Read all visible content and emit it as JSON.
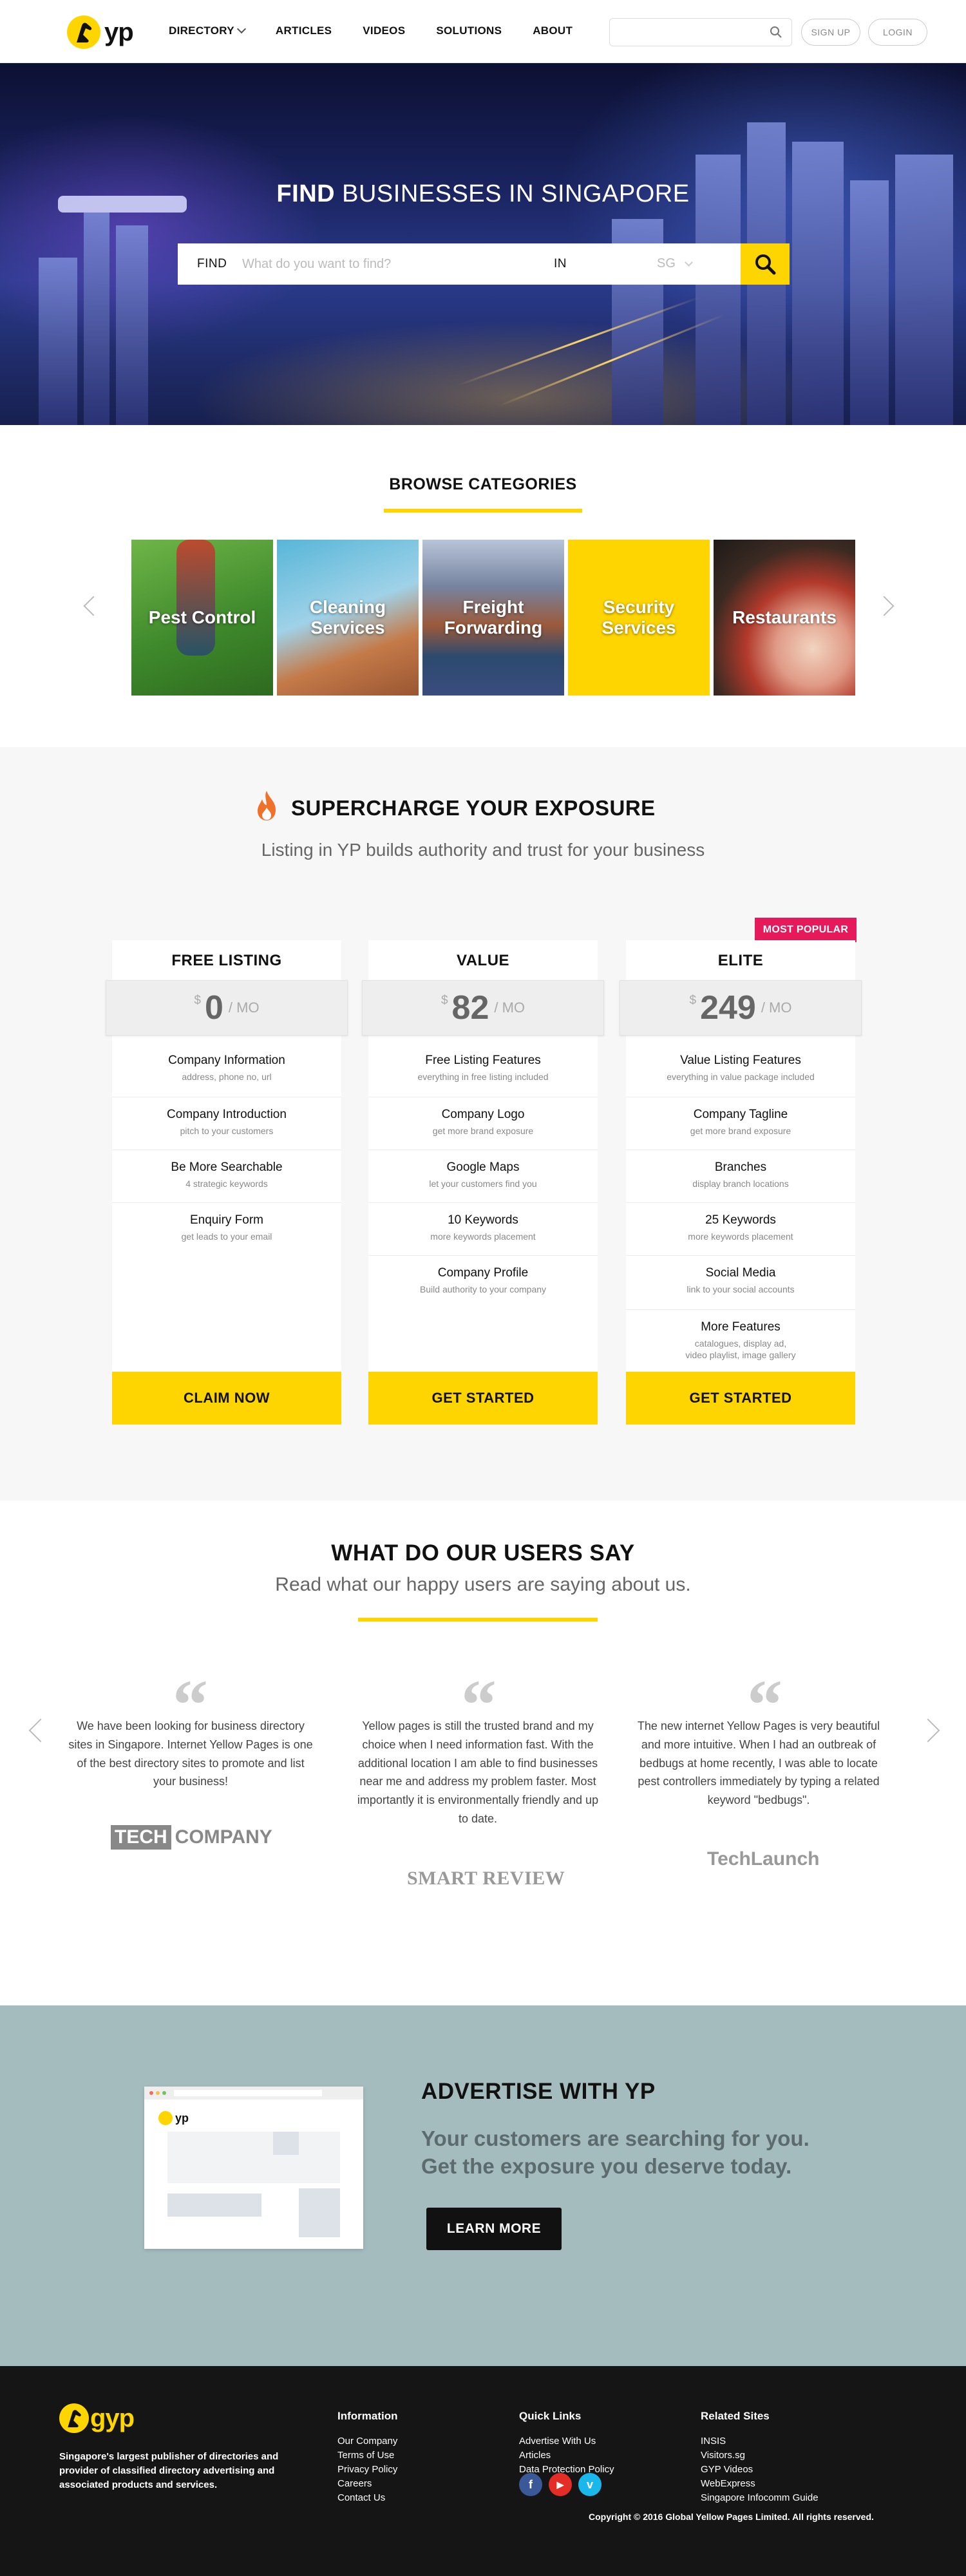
{
  "nav": {
    "logo_text": "yp",
    "menu": [
      {
        "label": "DIRECTORY",
        "has_dropdown": true
      },
      {
        "label": "ARTICLES"
      },
      {
        "label": "VIDEOS"
      },
      {
        "label": "SOLUTIONS"
      },
      {
        "label": "ABOUT"
      }
    ],
    "search_placeholder": "",
    "signup_label": "SIGN UP",
    "login_label": "LOGIN"
  },
  "hero": {
    "title_bold": "FIND",
    "title_rest": "BUSINESSES IN SINGAPORE",
    "find_label": "FIND",
    "find_placeholder": "What do you want to find?",
    "in_label": "IN",
    "location_value": "SG"
  },
  "categories": {
    "heading": "BROWSE CATEGORIES",
    "items": [
      {
        "label": "Pest Control"
      },
      {
        "label": "Cleaning Services"
      },
      {
        "label": "Freight Forwarding"
      },
      {
        "label": "Security Services"
      },
      {
        "label": "Restaurants"
      }
    ]
  },
  "pricing": {
    "title": "SUPERCHARGE YOUR EXPOSURE",
    "subtitle": "Listing in YP builds authority and trust for your business",
    "popular_badge": "MOST POPULAR",
    "plans": [
      {
        "name": "FREE LISTING",
        "currency": "$",
        "amount": "0",
        "per": "/ MO",
        "features": [
          {
            "title": "Company Information",
            "sub": "address, phone no, url"
          },
          {
            "title": "Company Introduction",
            "sub": "pitch to your customers"
          },
          {
            "title": "Be More Searchable",
            "sub": "4 strategic keywords"
          },
          {
            "title": "Enquiry Form",
            "sub": "get leads to your email"
          }
        ],
        "cta": "CLAIM NOW"
      },
      {
        "name": "VALUE",
        "currency": "$",
        "amount": "82",
        "per": "/ MO",
        "features": [
          {
            "title": "Free Listing Features",
            "sub": "everything in free listing included"
          },
          {
            "title": "Company Logo",
            "sub": "get more brand exposure"
          },
          {
            "title": "Google Maps",
            "sub": "let your customers find you"
          },
          {
            "title": "10 Keywords",
            "sub": "more keywords placement"
          },
          {
            "title": "Company Profile",
            "sub": "Build authority to your company"
          }
        ],
        "cta": "GET STARTED"
      },
      {
        "name": "ELITE",
        "currency": "$",
        "amount": "249",
        "per": "/ MO",
        "features": [
          {
            "title": "Value Listing Features",
            "sub": "everything in value package included"
          },
          {
            "title": "Company Tagline",
            "sub": "get more brand exposure"
          },
          {
            "title": "Branches",
            "sub": "display branch locations"
          },
          {
            "title": "25 Keywords",
            "sub": "more keywords placement"
          },
          {
            "title": "Social Media",
            "sub": "link to your social accounts"
          },
          {
            "title": "More Features",
            "sub": "catalogues, display ad,",
            "sub2": "video playlist, image gallery"
          }
        ],
        "cta": "GET STARTED"
      }
    ]
  },
  "testimonials": {
    "title": "WHAT DO OUR USERS SAY",
    "subtitle": "Read what our happy users are saying about us.",
    "items": [
      {
        "text": "We have been looking for business directory sites in Singapore. Internet Yellow Pages is one of the best directory sites to promote and list your business!",
        "brand_box": "TECH",
        "brand_rest": "COMPANY"
      },
      {
        "text": "Yellow pages is still the trusted brand and my choice when I need information fast. With the additional location I am able to find businesses near me and address my problem faster. Most importantly it is environmentally friendly and up to date.",
        "brand": "SMART REVIEW"
      },
      {
        "text": "The new internet Yellow Pages is very beautiful and more intuitive. When I had an outbreak of bedbugs at home recently, I was able to locate pest controllers immediately by typing a related keyword \"bedbugs\".",
        "brand": "TechLaunch"
      }
    ]
  },
  "advertise": {
    "mock_logo": "yp",
    "title": "ADVERTISE WITH YP",
    "line1": "Your customers are searching for you.",
    "line2": "Get the exposure you deserve today.",
    "button": "LEARN MORE"
  },
  "footer": {
    "logo_text": "gyp",
    "about": "Singapore's largest publisher of directories and provider of classified directory advertising and associated products and services.",
    "columns": [
      {
        "heading": "Information",
        "links": [
          "Our Company",
          "Terms of Use",
          "Privacy Policy",
          "Careers",
          "Contact Us"
        ]
      },
      {
        "heading": "Quick Links",
        "links": [
          "Advertise With Us",
          "Articles",
          "Data Protection Policy"
        ]
      },
      {
        "heading": "Related Sites",
        "links": [
          "INSIS",
          "Visitors.sg",
          "GYP Videos",
          "WebExpress",
          "Singapore Infocomm Guide"
        ]
      }
    ],
    "social": [
      "f",
      "▶",
      "v"
    ],
    "copyright": "Copyright © 2016 Global Yellow Pages Limited. All rights reserved."
  },
  "colors": {
    "brand_yellow": "#ffd500",
    "popular_pink": "#e6195a",
    "advertise_bg": "#a5bcbe",
    "footer_bg": "#151515"
  }
}
